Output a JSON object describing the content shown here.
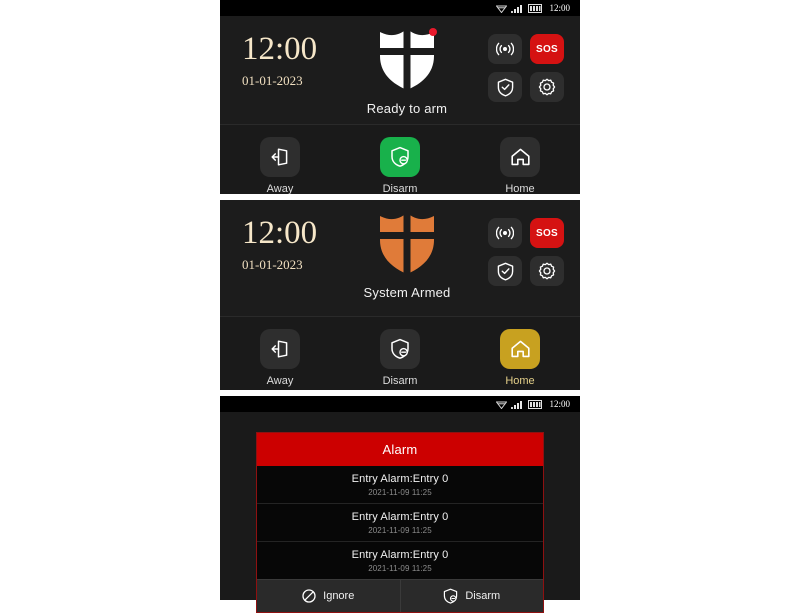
{
  "status_bar": {
    "time": "12:00",
    "icons": [
      "wifi-icon",
      "signal-icon",
      "battery-icon"
    ]
  },
  "colors": {
    "shield_ready": "#ffffff",
    "shield_armed": "#e07b39",
    "sos_red": "#d51212",
    "disarm_green": "#18b14b",
    "home_gold": "#c8a120",
    "alarm_red": "#cc0000",
    "clock_cream": "#f6e7c9",
    "panel_bg": "#1a1a1a"
  },
  "panels": [
    {
      "name": "ready-to-arm",
      "clock": {
        "time": "12:00",
        "date": "01-01-2023"
      },
      "status_text": "Ready to arm",
      "shield_has_badge": true,
      "quick_actions": [
        {
          "label": "",
          "icon": "broadcast-icon",
          "name": "siren-button"
        },
        {
          "label": "SOS",
          "icon": "sos-icon",
          "name": "sos-button"
        },
        {
          "label": "",
          "icon": "shield-check-icon",
          "name": "shield-status-button"
        },
        {
          "label": "",
          "icon": "gear-icon",
          "name": "settings-button"
        }
      ],
      "nav": [
        {
          "label": "Away",
          "icon": "exit-door-icon",
          "active": false
        },
        {
          "label": "Disarm",
          "icon": "shield-minus-icon",
          "active": true
        },
        {
          "label": "Home",
          "icon": "house-icon",
          "active": false
        }
      ]
    },
    {
      "name": "system-armed",
      "clock": {
        "time": "12:00",
        "date": "01-01-2023"
      },
      "status_text": "System Armed",
      "shield_has_badge": false,
      "quick_actions": [
        {
          "label": "",
          "icon": "broadcast-icon",
          "name": "siren-button"
        },
        {
          "label": "SOS",
          "icon": "sos-icon",
          "name": "sos-button"
        },
        {
          "label": "",
          "icon": "shield-check-icon",
          "name": "shield-status-button"
        },
        {
          "label": "",
          "icon": "gear-icon",
          "name": "settings-button"
        }
      ],
      "nav": [
        {
          "label": "Away",
          "icon": "exit-door-icon",
          "active": false
        },
        {
          "label": "Disarm",
          "icon": "shield-minus-icon",
          "active": false
        },
        {
          "label": "Home",
          "icon": "house-icon",
          "active": true
        }
      ]
    }
  ],
  "alarm_screen": {
    "status_bar_time": "12:00",
    "dialog": {
      "title": "Alarm",
      "events": [
        {
          "title": "Entry Alarm:Entry 0",
          "timestamp": "2021-11-09 11:25"
        },
        {
          "title": "Entry Alarm:Entry 0",
          "timestamp": "2021-11-09 11:25"
        },
        {
          "title": "Entry Alarm:Entry 0",
          "timestamp": "2021-11-09 11:25"
        }
      ],
      "actions": [
        {
          "label": "Ignore",
          "icon": "ban-icon"
        },
        {
          "label": "Disarm",
          "icon": "shield-minus-icon"
        }
      ]
    }
  }
}
